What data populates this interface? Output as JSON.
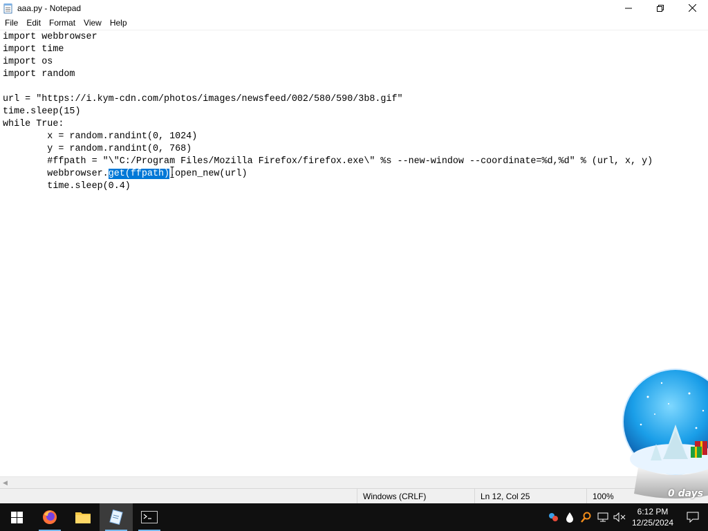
{
  "window": {
    "title": "aaa.py - Notepad",
    "controls": {
      "minimize": "—",
      "maximize": "❐",
      "close": "✕"
    }
  },
  "menu": [
    {
      "label": "File"
    },
    {
      "label": "Edit"
    },
    {
      "label": "Format"
    },
    {
      "label": "View"
    },
    {
      "label": "Help"
    }
  ],
  "editor": {
    "lines": [
      "import webbrowser",
      "import time",
      "import os",
      "import random",
      "",
      "url = \"https://i.kym-cdn.com/photos/images/newsfeed/002/580/590/3b8.gif\"",
      "time.sleep(15)",
      "while True:",
      "        x = random.randint(0, 1024)",
      "        y = random.randint(0, 768)",
      "        #ffpath = \"\\\"C:/Program Files/Mozilla Firefox/firefox.exe\\\" %s --new-window --coordinate=%d,%d\" % (url, x, y)",
      "        webbrowser.get(ffpath).open_new(url)",
      "        time.sleep(0.4)"
    ],
    "selection": {
      "line_before": "        webbrowser.",
      "selected": "get(ffpath)",
      "line_after": ".open_new(url)"
    }
  },
  "statusbar": {
    "encoding": "Windows (CRLF)",
    "position": "Ln 12, Col 25",
    "zoom": "100%"
  },
  "taskbar": {
    "apps": [
      "start",
      "firefox",
      "file-explorer",
      "notepad",
      "terminal"
    ],
    "clock_time": "6:12 PM",
    "clock_date": "12/25/2024"
  },
  "gadget": {
    "text": "0 days"
  },
  "colors": {
    "selection": "#0078d7",
    "taskbar": "#101010",
    "statusbar": "#f0f0f0"
  }
}
